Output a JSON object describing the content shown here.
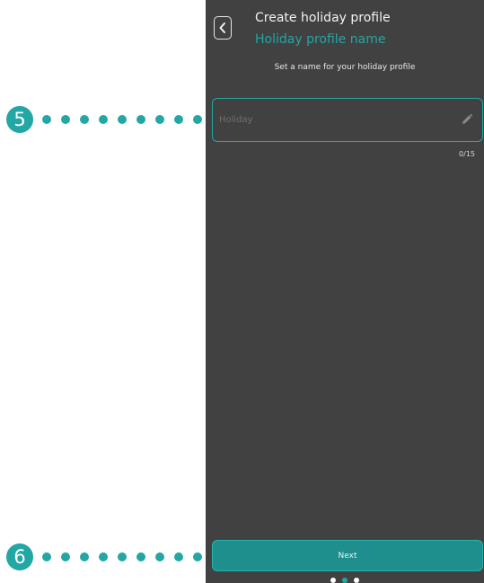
{
  "screen": {
    "header": {
      "title": "Create holiday profile",
      "subtitle": "Holiday profile name"
    },
    "instruction": "Set a name for your holiday profile",
    "name_field": {
      "value": "",
      "placeholder": "Holiday",
      "edit_icon": "pencil-icon"
    },
    "char_counter": "0/15",
    "next_button_label": "Next",
    "page_indicator": {
      "total": 3,
      "active": 2
    }
  },
  "callouts": [
    {
      "number": "5",
      "target": "name-field"
    },
    {
      "number": "6",
      "target": "next-button"
    }
  ],
  "colors": {
    "accent": "#22a7a4",
    "screen_background": "#414141",
    "button_fill": "#1e8f8c",
    "text_light": "#f2f2f2"
  }
}
